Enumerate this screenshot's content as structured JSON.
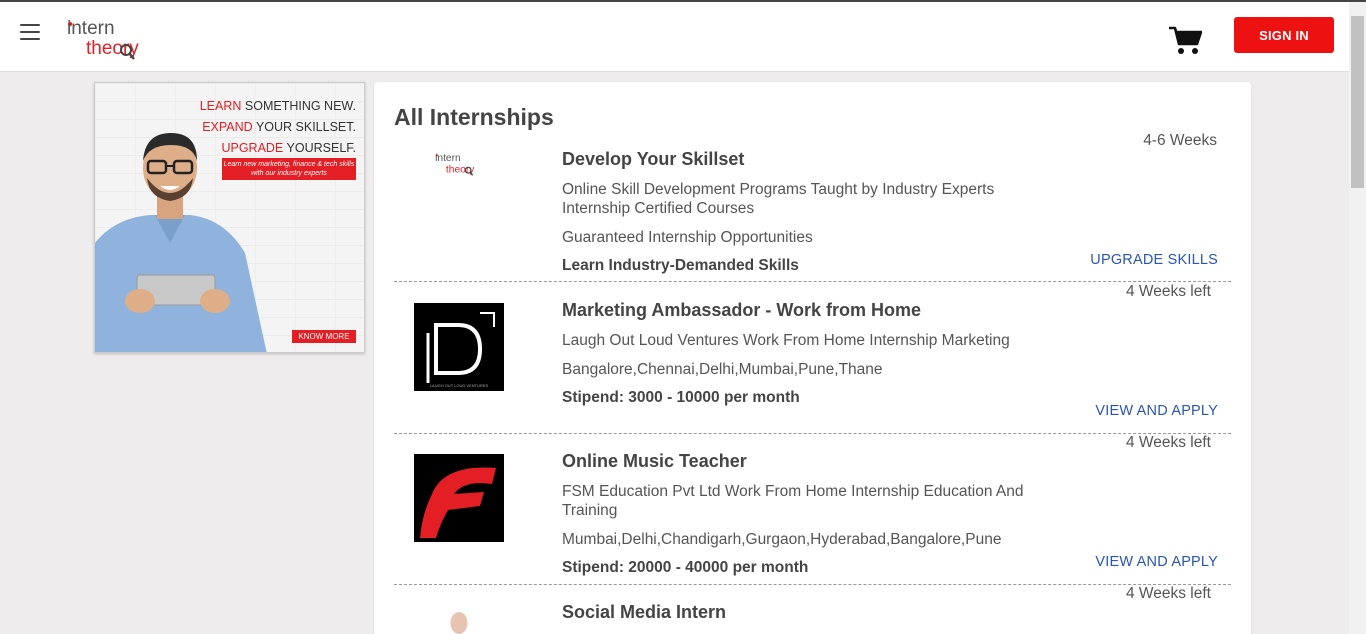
{
  "header": {
    "logo_text_top": "intern",
    "logo_text_bottom": "theory",
    "signin_label": "SIGN IN"
  },
  "ad": {
    "line1_red": "LEARN",
    "line1_rest": " SOMETHING NEW.",
    "line2_red": "EXPAND",
    "line2_rest": " YOUR SKILLSET.",
    "line3_red": "UPGRADE",
    "line3_rest": " YOURSELF.",
    "sub": "Learn new marketing, finance & tech skills with our industry experts",
    "cta": "KNOW MORE"
  },
  "main": {
    "title": "All Internships",
    "items": [
      {
        "title": "Develop Your Skillset",
        "line1": "Online Skill Development Programs Taught by Industry Experts Internship Certified Courses",
        "line2": "Guaranteed Internship Opportunities",
        "bold": "Learn Industry-Demanded Skills",
        "duration": "4-6 Weeks",
        "action": "UPGRADE SKILLS"
      },
      {
        "title": "Marketing Ambassador - Work from Home",
        "line1": "Laugh Out Loud Ventures Work From Home Internship Marketing",
        "line2": "Bangalore,Chennai,Delhi,Mumbai,Pune,Thane",
        "bold": "Stipend: 3000 - 10000 per month",
        "duration": "4 Weeks left",
        "action": "VIEW AND APPLY",
        "logo_caption": "LAUGH OUT LOUD VENTURES"
      },
      {
        "title": "Online Music Teacher",
        "line1": "FSM Education Pvt Ltd Work From Home Internship Education And Training",
        "line2": "Mumbai,Delhi,Chandigarh,Gurgaon,Hyderabad,Bangalore,Pune",
        "bold": "Stipend: 20000 - 40000 per month",
        "duration": "4 Weeks left",
        "action": "VIEW AND APPLY"
      },
      {
        "title": "Social Media Intern",
        "duration": "4 Weeks left"
      }
    ]
  },
  "colors": {
    "brand_red": "#ee1111",
    "link_blue": "#2a55b8",
    "page_bg": "#eeeced"
  }
}
